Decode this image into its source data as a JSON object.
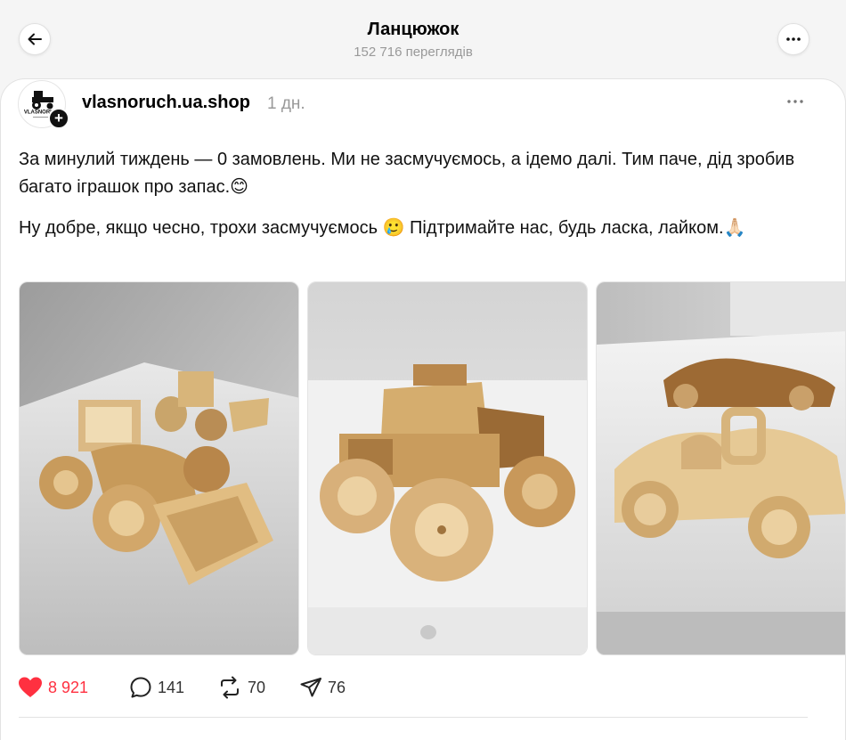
{
  "header": {
    "title": "Ланцюжок",
    "views": "152 716 переглядів",
    "back_icon": "arrow-left-icon",
    "more_icon": "more-horizontal-icon"
  },
  "post": {
    "avatar_label": "VLASNORUCH",
    "username": "vlasnoruch.ua.shop",
    "time": "1 дн.",
    "paragraph1": "За минулий тиждень — 0 замовлень. Ми не засмучуємось, а ідемо далі. Тим паче, дід зробив багато іграшок про запас.😊",
    "paragraph2": "Ну добре, якщо чесно, трохи засмучуємось 🥲 Підтримайте нас, будь ласка, лайком.🙏🏻",
    "images": [
      {
        "icon": "wooden-tractor-photo"
      },
      {
        "icon": "wooden-truck-photo"
      },
      {
        "icon": "wooden-car-photo"
      }
    ]
  },
  "actions": {
    "likes": "8 921",
    "comments": "141",
    "reposts": "70",
    "shares": "76",
    "like_color": "#ff3040"
  }
}
